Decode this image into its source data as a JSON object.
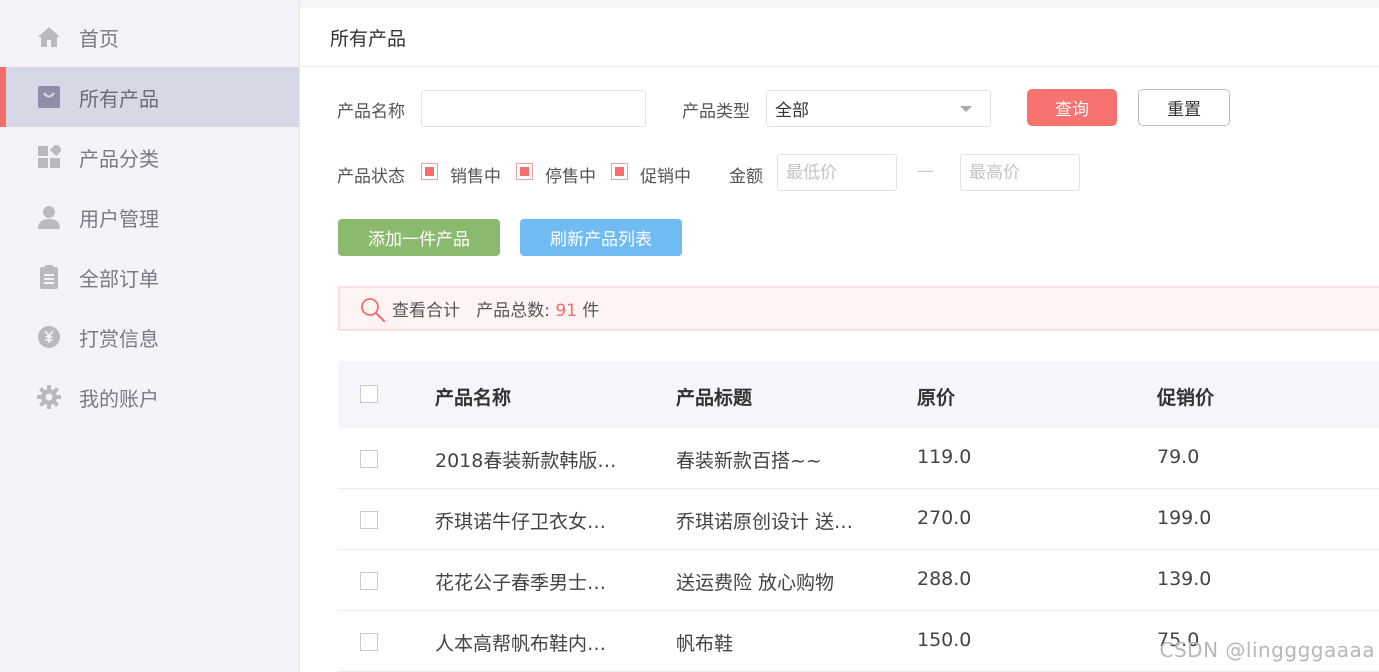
{
  "sidebar": {
    "items": [
      {
        "label": "首页",
        "icon": "home-icon",
        "active": false
      },
      {
        "label": "所有产品",
        "icon": "shopping-bag-icon",
        "active": true
      },
      {
        "label": "产品分类",
        "icon": "category-grid-icon",
        "active": false
      },
      {
        "label": "用户管理",
        "icon": "user-icon",
        "active": false
      },
      {
        "label": "全部订单",
        "icon": "clipboard-icon",
        "active": false
      },
      {
        "label": "打赏信息",
        "icon": "yen-coin-icon",
        "active": false
      },
      {
        "label": "我的账户",
        "icon": "gear-icon",
        "active": false
      }
    ]
  },
  "page": {
    "title": "所有产品"
  },
  "filters": {
    "name_label": "产品名称",
    "name_value": "",
    "type_label": "产品类型",
    "type_value": "全部",
    "query_label": "查询",
    "reset_label": "重置",
    "status_label": "产品状态",
    "status_options": [
      {
        "label": "销售中",
        "checked": true
      },
      {
        "label": "停售中",
        "checked": true
      },
      {
        "label": "促销中",
        "checked": true
      }
    ],
    "amount_label": "金额",
    "min_placeholder": "最低价",
    "dash": "—",
    "max_placeholder": "最高价"
  },
  "actions": {
    "add_label": "添加一件产品",
    "refresh_label": "刷新产品列表"
  },
  "summary": {
    "view_label": "查看合计",
    "total_label": "产品总数:",
    "total_count": "91",
    "unit": "件"
  },
  "table": {
    "columns": [
      "产品名称",
      "产品标题",
      "原价",
      "促销价"
    ],
    "rows": [
      {
        "name": "2018春装新款韩版…",
        "title": "春装新款百搭~~",
        "price": "119.0",
        "promo": "79.0"
      },
      {
        "name": "乔琪诺牛仔卫衣女…",
        "title": "乔琪诺原创设计 送…",
        "price": "270.0",
        "promo": "199.0"
      },
      {
        "name": "花花公子春季男士…",
        "title": "送运费险 放心购物",
        "price": "288.0",
        "promo": "139.0"
      },
      {
        "name": "人本高帮帆布鞋内…",
        "title": "帆布鞋",
        "price": "150.0",
        "promo": "75.0"
      }
    ]
  },
  "watermark": "CSDN @linggggaaaa",
  "colors": {
    "accent": "#f36d6b",
    "add_button": "#8bba6f",
    "refresh_button": "#6fbbf2",
    "sidebar_active": "#d7d8e6"
  }
}
